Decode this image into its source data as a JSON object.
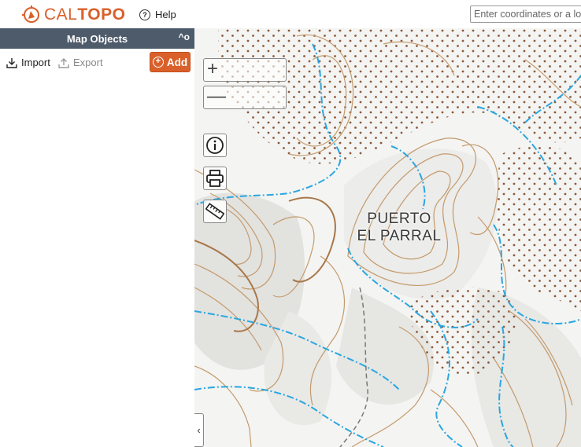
{
  "header": {
    "logo_part1": "CAL",
    "logo_part2": "TOPO",
    "help_label": "Help",
    "search_placeholder": "Enter coordinates or a location"
  },
  "sidebar": {
    "title": "Map Objects",
    "collapse_label": "^o",
    "import_label": "Import",
    "export_label": "Export",
    "add_label": "Add"
  },
  "map": {
    "place_name_line1": "PUERTO",
    "place_name_line2": "EL PARRAL",
    "zoom_in": "+",
    "zoom_out": "—",
    "toggle_sidebar": "‹"
  },
  "colors": {
    "brand": "#d9602b",
    "panel_header": "#4d5b6b",
    "contour": "#c49a6c",
    "water": "#2aa6e0"
  },
  "icons": [
    "compass-logo-icon",
    "help-icon",
    "import-icon",
    "export-icon",
    "add-plus-icon",
    "info-icon",
    "print-icon",
    "ruler-icon",
    "chevron-left-icon"
  ]
}
